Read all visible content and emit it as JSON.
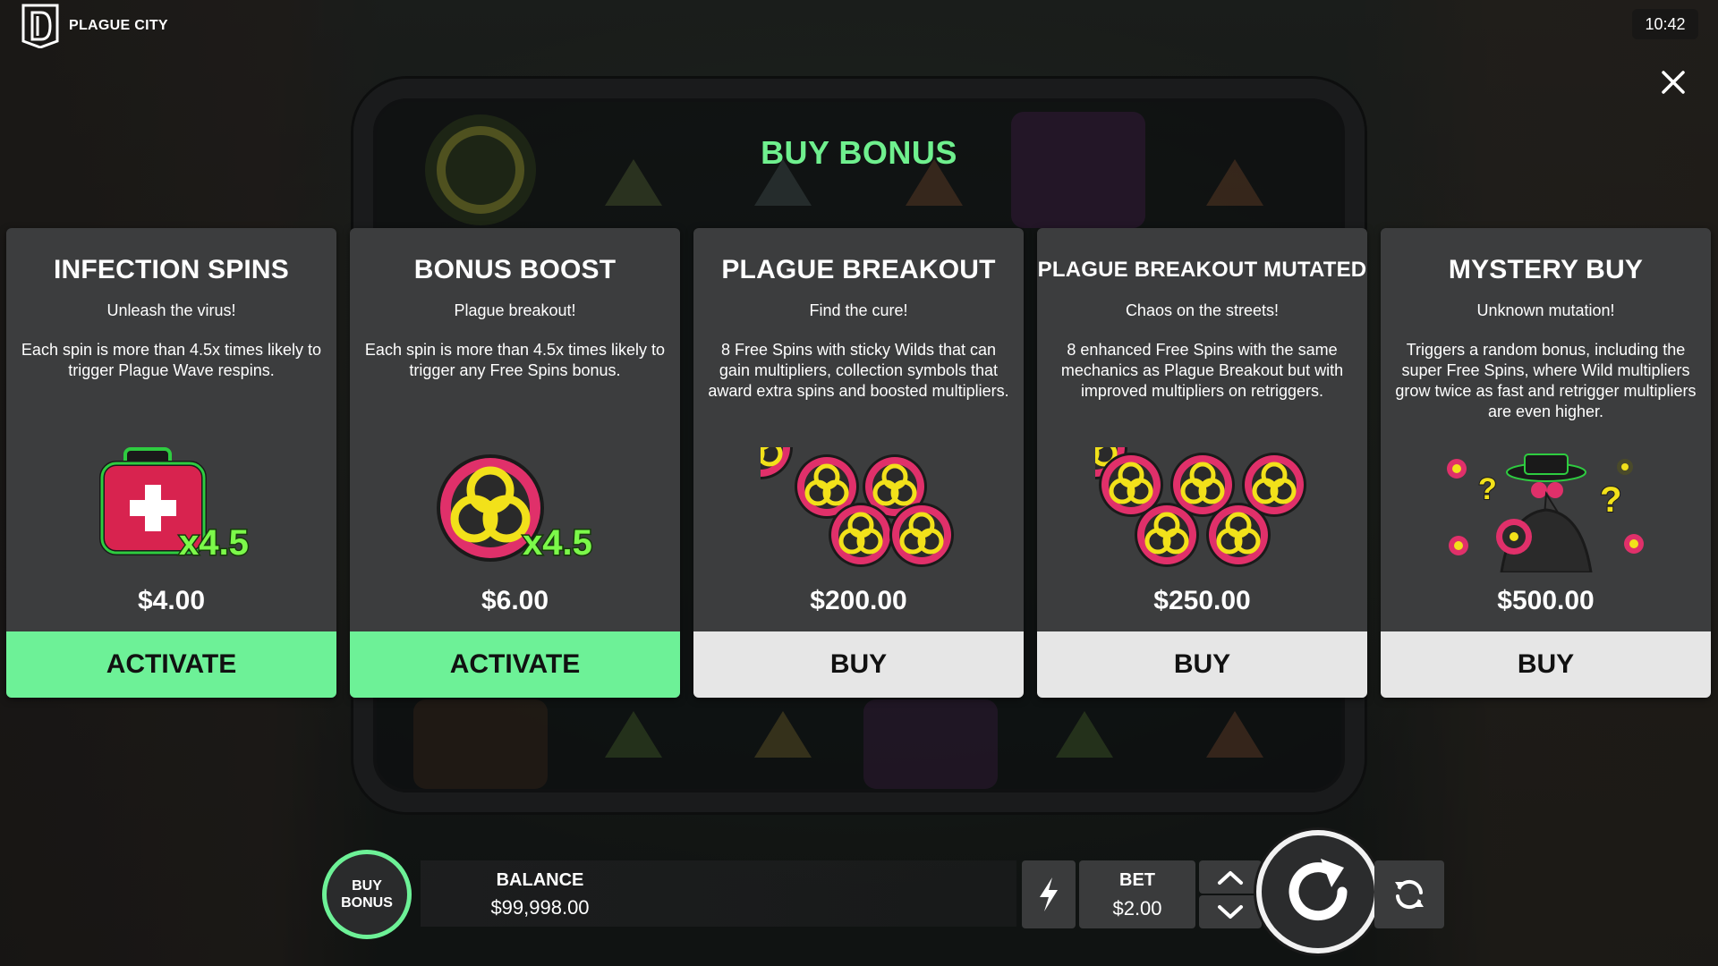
{
  "game": {
    "title": "PLAGUE CITY",
    "clock": "10:42"
  },
  "modal": {
    "heading": "BUY BONUS",
    "close_icon": "close-icon"
  },
  "cards": [
    {
      "title": "INFECTION SPINS",
      "subtitle": "Unleash the virus!",
      "description": "Each spin is more than 4.5x times likely to trigger Plague Wave respins.",
      "art_label": "x4.5",
      "art_icon": "medkit-icon",
      "price": "$4.00",
      "button": "ACTIVATE",
      "button_style": "green"
    },
    {
      "title": "BONUS BOOST",
      "subtitle": "Plague breakout!",
      "description": "Each spin is more than 4.5x times likely to trigger any Free Spins bonus.",
      "art_label": "x4.5",
      "art_icon": "biohazard-icon",
      "price": "$6.00",
      "button": "ACTIVATE",
      "button_style": "green"
    },
    {
      "title": "PLAGUE BREAKOUT",
      "subtitle": "Find the cure!",
      "description": "8 Free Spins with sticky Wilds that can gain multipliers, collection symbols that award extra spins and boosted multipliers.",
      "art_icon": "biohazard-cluster-icon",
      "price": "$200.00",
      "button": "BUY",
      "button_style": "grey"
    },
    {
      "title": "PLAGUE BREAKOUT MUTATED",
      "subtitle": "Chaos on the streets!",
      "description": "8 enhanced Free Spins with the same mechanics as Plague Breakout but with improved multipliers on retriggers.",
      "art_icon": "biohazard-cluster-large-icon",
      "price": "$250.00",
      "button": "BUY",
      "button_style": "grey"
    },
    {
      "title": "MYSTERY BUY",
      "subtitle": "Unknown mutation!",
      "description": "Triggers a random bonus, including the super Free Spins, where Wild multipliers grow twice as fast and retrigger multipliers are even higher.",
      "art_icon": "plague-doctor-icon",
      "price": "$500.00",
      "button": "BUY",
      "button_style": "grey"
    }
  ],
  "bottom_bar": {
    "buy_bonus_line1": "BUY",
    "buy_bonus_line2": "BONUS",
    "balance_label": "BALANCE",
    "balance_value": "$99,998.00",
    "bet_label": "BET",
    "bet_value": "$2.00",
    "turbo_icon": "lightning-icon",
    "spin_icon": "spin-arrow-icon",
    "autoplay_icon": "autoplay-icon"
  },
  "colors": {
    "accent_green": "#6df197",
    "heading_green": "#6ff08e",
    "card_bg": "#3c3d3e",
    "buy_button_bg": "#e6e6e6"
  }
}
